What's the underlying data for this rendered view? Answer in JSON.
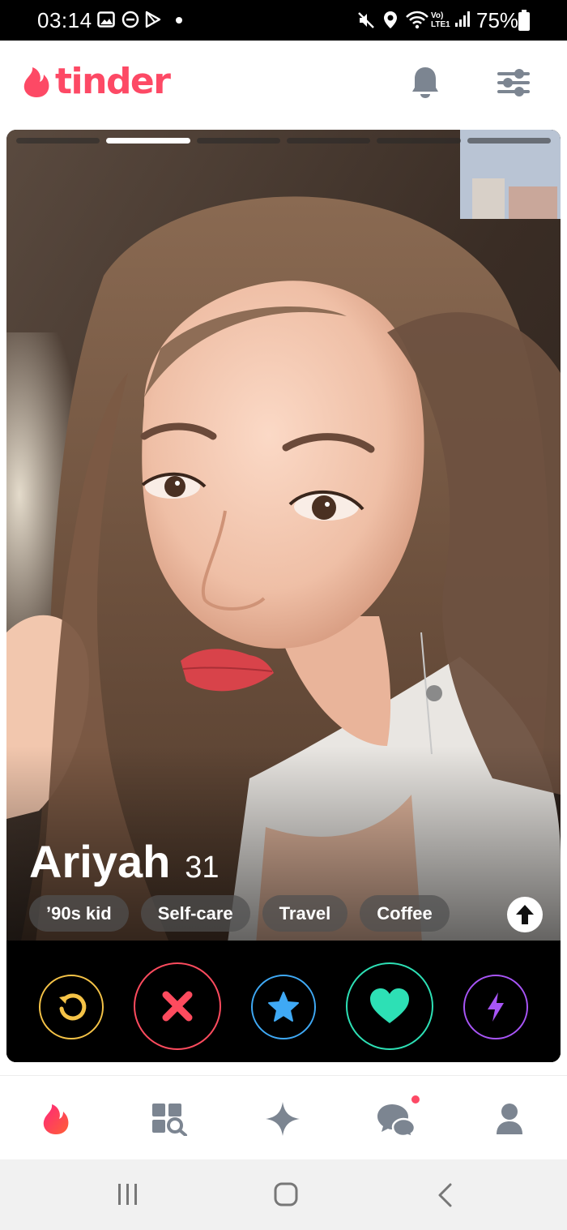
{
  "status_bar": {
    "time": "03:14",
    "battery_percent": "75%",
    "network_label": "Vo) LTE1",
    "left_icons": [
      "gallery-icon",
      "do-not-disturb-icon",
      "play-store-icon",
      "dot-icon"
    ],
    "right_icons": [
      "mute-icon",
      "location-icon",
      "wifi-icon",
      "signal-icon",
      "battery-icon"
    ]
  },
  "header": {
    "logo_text": "tinder",
    "brand_color": "#fd4965",
    "buttons": [
      "notifications-bell-icon",
      "filters-icon"
    ]
  },
  "card": {
    "photo_count": 6,
    "active_photo_index": 2,
    "name": "Ariyah",
    "age": "31",
    "interests": [
      {
        "label": "’90s kid"
      },
      {
        "label": "Self-care"
      },
      {
        "label": "Travel"
      },
      {
        "label": "Coffee"
      }
    ],
    "actions": [
      {
        "name": "rewind",
        "color": "#f5c347"
      },
      {
        "name": "nope",
        "color": "#fd4b5e"
      },
      {
        "name": "super-like",
        "color": "#3fa9f5"
      },
      {
        "name": "like",
        "color": "#2de0b5"
      },
      {
        "name": "boost",
        "color": "#a855f7"
      }
    ]
  },
  "bottom_nav": {
    "items": [
      {
        "name": "home",
        "icon": "flame-icon",
        "active": true
      },
      {
        "name": "explore",
        "icon": "explore-icon"
      },
      {
        "name": "gold",
        "icon": "sparkle-icon"
      },
      {
        "name": "messages",
        "icon": "chat-icon",
        "badge": true
      },
      {
        "name": "profile",
        "icon": "user-icon"
      }
    ]
  },
  "system_nav": [
    "recents-icon",
    "home-icon",
    "back-icon"
  ]
}
